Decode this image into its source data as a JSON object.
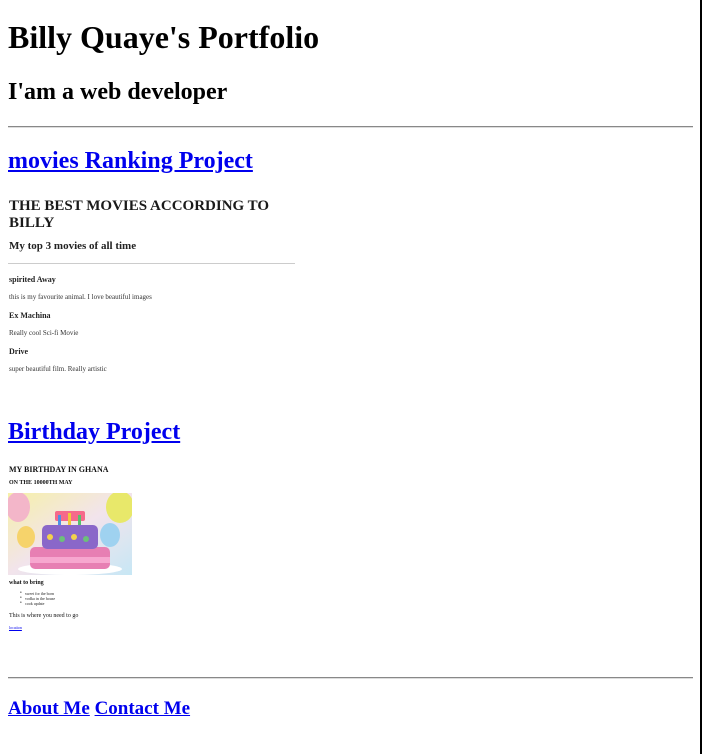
{
  "header": {
    "title": "Billy Quaye's Portfolio",
    "subtitle": "I'am a web developer"
  },
  "projects": {
    "movies": {
      "link_label": "movies Ranking Project",
      "preview": {
        "heading": "THE BEST MOVIES ACCORDING TO BILLY",
        "subheading": "My top 3 movies of all time",
        "movies": [
          {
            "title": "spirited Away",
            "description": "this is my favourite animal. I love beautiful images"
          },
          {
            "title": "Ex Machina",
            "description": "Really cool Sci-fi Movie"
          },
          {
            "title": "Drive",
            "description": "super beautiful film. Really artistic"
          }
        ]
      }
    },
    "birthday": {
      "link_label": "Birthday Project",
      "preview": {
        "heading": "MY BIRTHDAY IN GHANA",
        "subheading": "ON THE 10000TH MAY",
        "what_to_bring": "what to bring",
        "items": [
          "sweet for the born",
          "vodka in the house",
          "cook update"
        ],
        "where": "This is where you need to go",
        "map_link": "location"
      }
    }
  },
  "footer": {
    "about": "About Me",
    "contact": "Contact Me"
  }
}
